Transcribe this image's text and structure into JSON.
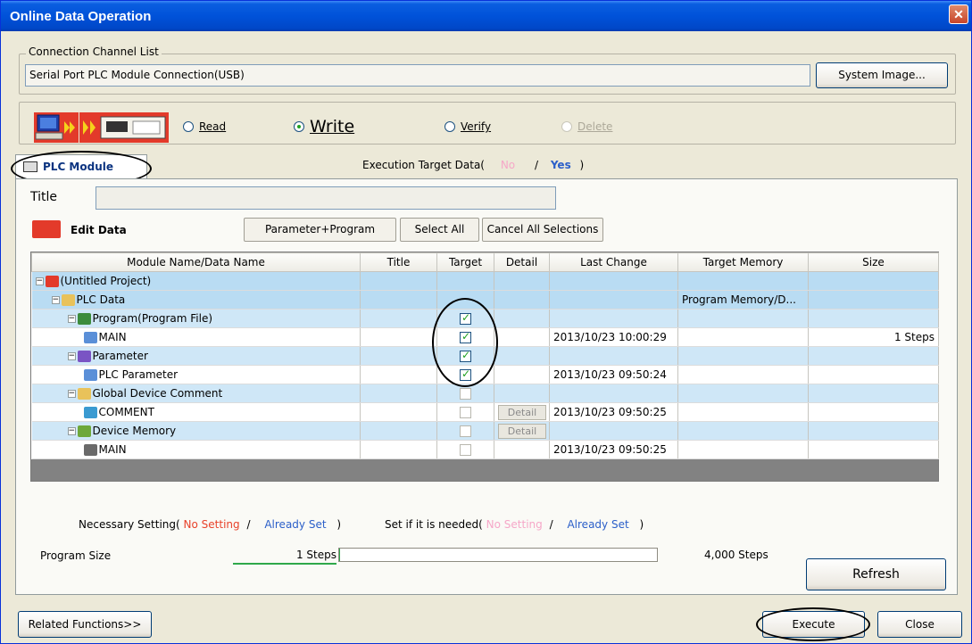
{
  "window": {
    "title": "Online Data Operation",
    "close_glyph": "✕"
  },
  "connection": {
    "group_label": "Connection Channel List",
    "value": "Serial Port  PLC Module Connection(USB)",
    "system_image_button": "System Image..."
  },
  "operations": [
    {
      "label": "Read",
      "checked": false,
      "disabled": false
    },
    {
      "label": "Write",
      "checked": true,
      "disabled": false
    },
    {
      "label": "Verify",
      "checked": false,
      "disabled": false
    },
    {
      "label": "Delete",
      "checked": false,
      "disabled": true
    }
  ],
  "tab": {
    "label": "PLC Module",
    "icon": "plc-module-icon"
  },
  "execution_target": {
    "prefix": "Execution Target Data(",
    "no": "No",
    "sep": "/",
    "yes": "Yes",
    "suffix": ")"
  },
  "title_field": {
    "label": "Title",
    "value": ""
  },
  "edit_data": {
    "label": "Edit Data",
    "buttons": {
      "param_program": "Parameter+Program",
      "select_all": "Select All",
      "cancel_all": "Cancel All Selections"
    }
  },
  "grid": {
    "columns": [
      "Module Name/Data Name",
      "Title",
      "Target",
      "Detail",
      "Last Change",
      "Target Memory",
      "Size"
    ],
    "rows": [
      {
        "name": "(Untitled Project)",
        "level": 0,
        "icon": "project-icon",
        "expander": "−",
        "target": null,
        "detail": "",
        "last_change": "",
        "memory": "",
        "size": "",
        "style": "sel"
      },
      {
        "name": "PLC Data",
        "level": 1,
        "icon": "folder-icon",
        "expander": "−",
        "target": null,
        "detail": "",
        "last_change": "",
        "memory": "Program Memory/D...",
        "size": "",
        "style": "sel"
      },
      {
        "name": "Program(Program File)",
        "level": 2,
        "icon": "program-file-icon",
        "expander": "−",
        "target": "checked",
        "detail": "",
        "last_change": "",
        "memory": "",
        "size": "",
        "style": "hl"
      },
      {
        "name": "MAIN",
        "level": 3,
        "icon": "program-icon",
        "expander": "",
        "target": "checked",
        "detail": "",
        "last_change": "2013/10/23 10:00:29",
        "memory": "",
        "size": "1 Steps",
        "style": ""
      },
      {
        "name": "Parameter",
        "level": 2,
        "icon": "parameter-icon",
        "expander": "−",
        "target": "checked",
        "detail": "",
        "last_change": "",
        "memory": "",
        "size": "",
        "style": "hl"
      },
      {
        "name": "PLC Parameter",
        "level": 3,
        "icon": "plc-parameter-icon",
        "expander": "",
        "target": "checked",
        "detail": "",
        "last_change": "2013/10/23 09:50:24",
        "memory": "",
        "size": "",
        "style": ""
      },
      {
        "name": "Global Device Comment",
        "level": 2,
        "icon": "folder-icon",
        "expander": "−",
        "target": "unchecked",
        "detail": "",
        "last_change": "",
        "memory": "",
        "size": "",
        "style": "hl"
      },
      {
        "name": "COMMENT",
        "level": 3,
        "icon": "comment-icon",
        "expander": "",
        "target": "unchecked",
        "detail": "Detail",
        "last_change": "2013/10/23 09:50:25",
        "memory": "",
        "size": "",
        "style": ""
      },
      {
        "name": "Device Memory",
        "level": 2,
        "icon": "device-memory-icon",
        "expander": "−",
        "target": "unchecked",
        "detail": "Detail",
        "last_change": "",
        "memory": "",
        "size": "",
        "style": "hl"
      },
      {
        "name": "MAIN",
        "level": 3,
        "icon": "device-memory-file-icon",
        "expander": "",
        "target": "unchecked",
        "detail": "",
        "last_change": "2013/10/23 09:50:25",
        "memory": "",
        "size": "",
        "style": ""
      }
    ]
  },
  "legend": {
    "necessary_prefix": "Necessary Setting(",
    "no_setting": "No Setting",
    "slash": "/",
    "already_set": "Already Set",
    "close_paren": ")",
    "if_needed_prefix": "Set if it is needed(",
    "no_setting_2": "No Setting",
    "slash_2": "/",
    "already_set_2": "Already Set",
    "close_paren_2": ")"
  },
  "program_size": {
    "label": "Program Size",
    "current": "1 Steps",
    "max": "4,000 Steps",
    "fill_fraction": 0.00025
  },
  "buttons": {
    "refresh": "Refresh",
    "related": "Related Functions>>",
    "execute": "Execute",
    "close": "Close"
  },
  "colors": {
    "not_set": "#e8422a",
    "not_set_optional": "#f6a7c8",
    "already_set": "#2b5fc9",
    "selection": "#b9dcf3"
  }
}
